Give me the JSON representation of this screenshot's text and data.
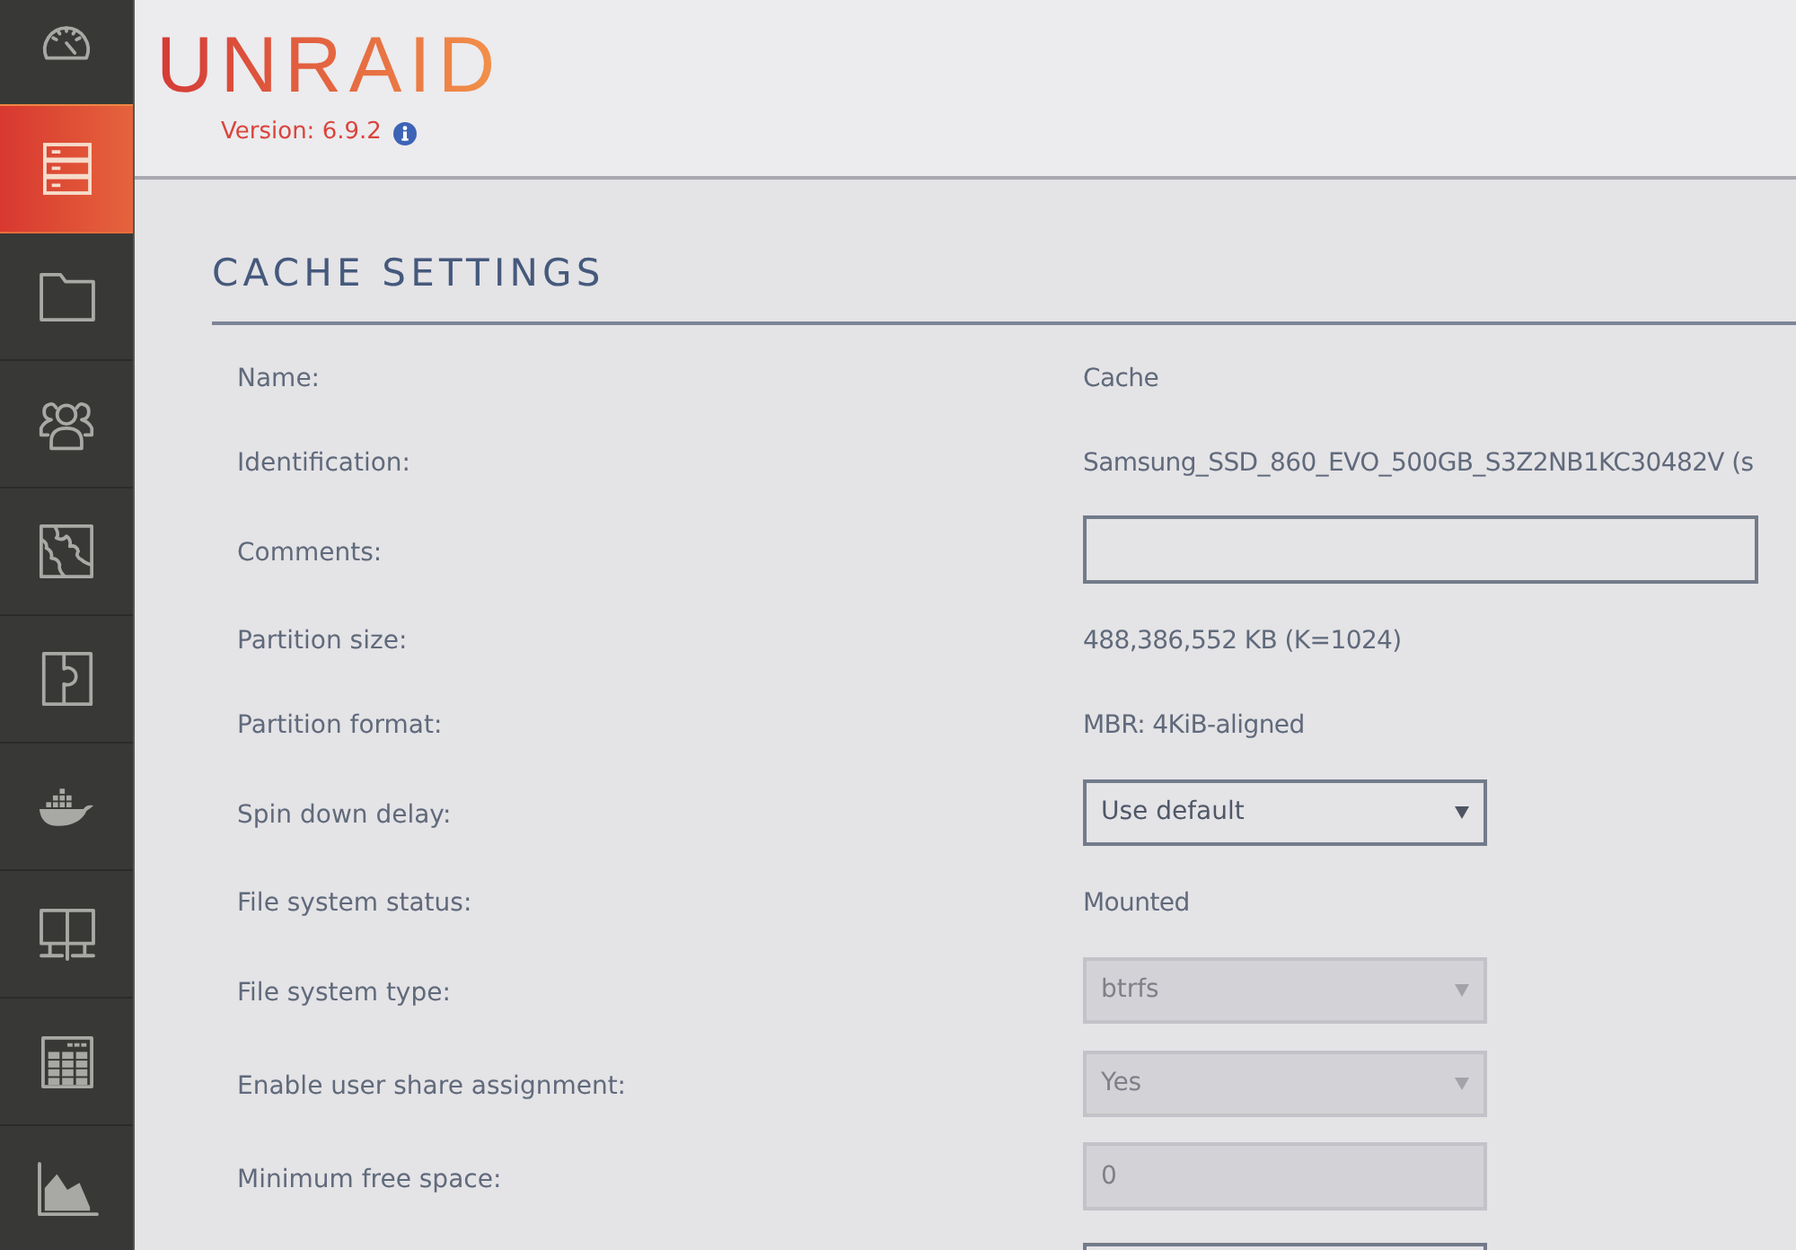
{
  "sidebar": {
    "items": [
      {
        "selected": false
      },
      {
        "selected": true
      },
      {
        "selected": false
      },
      {
        "selected": false
      },
      {
        "selected": false
      },
      {
        "selected": false
      },
      {
        "selected": false
      },
      {
        "selected": false
      },
      {
        "selected": false
      },
      {
        "selected": false
      }
    ]
  },
  "header": {
    "logo": "UNRAID",
    "version": "Version: 6.9.2"
  },
  "section": {
    "title": "CACHE SETTINGS"
  },
  "settings": [
    {
      "kind": "text",
      "label": "Name:",
      "value": "Cache"
    },
    {
      "kind": "text",
      "label": "Identification:",
      "value": "Samsung_SSD_860_EVO_500GB_S3Z2NB1KC30482V (s"
    },
    {
      "kind": "input",
      "label": "Comments:",
      "disabled": false
    },
    {
      "kind": "text",
      "label": "Partition size:",
      "value": "488,386,552 KB (K=1024)"
    },
    {
      "kind": "text",
      "label": "Partition format:",
      "value": "MBR: 4KiB-aligned"
    },
    {
      "kind": "select",
      "label": "Spin down delay:",
      "value": "Use default",
      "disabled": false
    },
    {
      "kind": "text",
      "label": "File system status:",
      "value": "Mounted"
    },
    {
      "kind": "select",
      "label": "File system type:",
      "value": "btrfs",
      "disabled": true
    },
    {
      "kind": "select",
      "label": "Enable user share assignment:",
      "value": "Yes",
      "disabled": true
    },
    {
      "kind": "input",
      "label": "Minimum free space:",
      "value": "0",
      "disabled": true
    },
    {
      "kind": "input",
      "disabled": false
    }
  ]
}
